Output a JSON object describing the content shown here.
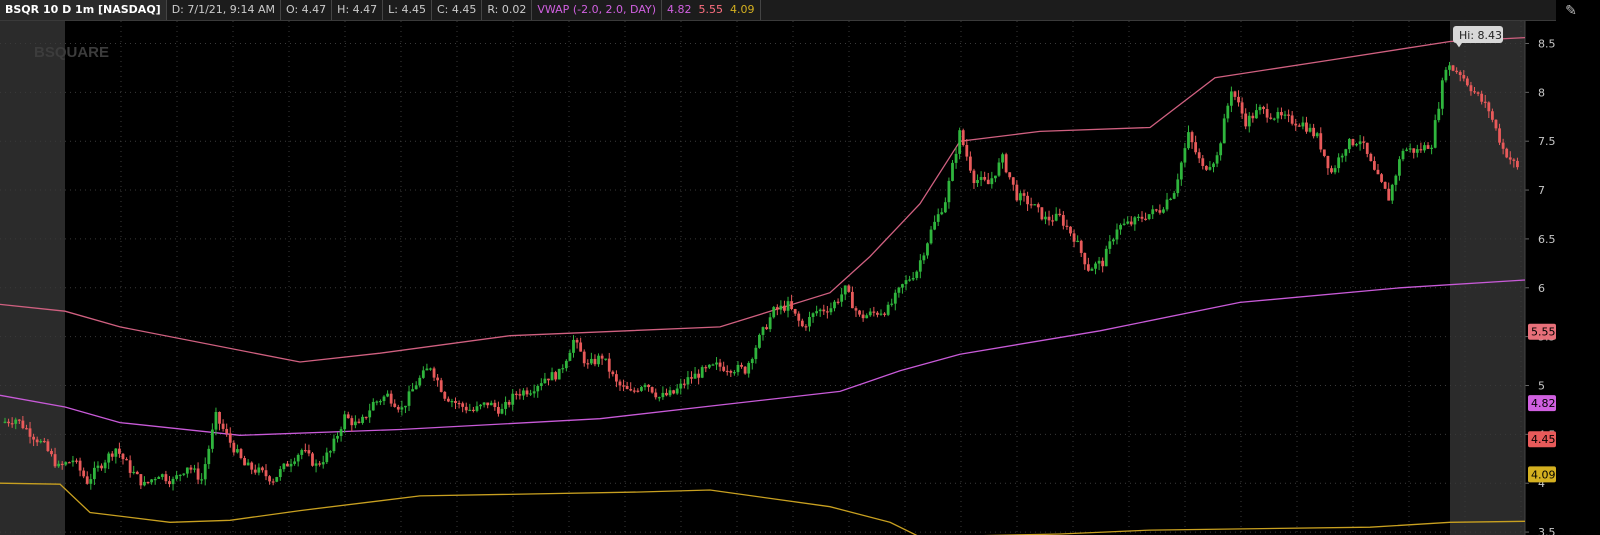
{
  "header": {
    "symbol": "BSQR 10 D 1m [NASDAQ]",
    "date": "D: 7/1/21, 9:14 AM",
    "open": "O: 4.47",
    "high": "H: 4.47",
    "low": "L: 4.45",
    "close": "C: 4.45",
    "range": "R: 0.02",
    "vwap_label": "VWAP (-2.0, 2.0, DAY)",
    "vwap_value": "4.82",
    "upper_value": "5.55",
    "lower_value": "4.09"
  },
  "watermark": "BSQUARE",
  "tools_icon": "pin-icon",
  "colors": {
    "up": "#2fb53d",
    "down": "#e85a5a",
    "vwap": "#c85ad8",
    "upper_band": "#d06080",
    "lower_band": "#c8a020",
    "extended_hours": "#2b2b2b"
  },
  "chart_data": {
    "type": "candlestick",
    "y_ticks": [
      "8.5",
      "8",
      "7.5",
      "7",
      "6.5",
      "6",
      "5.5",
      "5",
      "4.5",
      "4",
      "3.5"
    ],
    "ylim": [
      3.47,
      8.73
    ],
    "price_tags": [
      {
        "label": "5.55",
        "value": 5.55,
        "color": "#e8707a"
      },
      {
        "label": "4.82",
        "value": 4.82,
        "color": "#d060e0"
      },
      {
        "label": "4.45",
        "value": 4.45,
        "color": "#e85a5a"
      },
      {
        "label": "4.09",
        "value": 4.09,
        "color": "#d4b020"
      }
    ],
    "hi_label": "Hi: 8.43",
    "hi_value": 8.43,
    "close_path": [
      4.62,
      4.66,
      4.52,
      4.38,
      4.16,
      4.24,
      4.02,
      4.2,
      4.36,
      4.14,
      3.98,
      4.1,
      4.02,
      4.18,
      4.04,
      4.68,
      4.42,
      4.18,
      4.12,
      4.04,
      4.2,
      4.34,
      4.18,
      4.32,
      4.68,
      4.58,
      4.82,
      4.9,
      4.76,
      5.02,
      5.2,
      4.9,
      4.8,
      4.74,
      4.82,
      4.74,
      4.92,
      4.96,
      5.08,
      5.12,
      5.46,
      5.2,
      5.3,
      5.02,
      4.92,
      5.04,
      4.88,
      4.92,
      5.06,
      5.14,
      5.2,
      5.18,
      5.16,
      5.48,
      5.76,
      5.82,
      5.6,
      5.76,
      5.8,
      5.98,
      5.7,
      5.74,
      5.78,
      6.02,
      6.18,
      6.58,
      6.9,
      7.58,
      7.12,
      7.06,
      7.32,
      6.94,
      6.86,
      6.7,
      6.72,
      6.52,
      6.2,
      6.26,
      6.62,
      6.66,
      6.74,
      6.8,
      7.0,
      7.56,
      7.22,
      7.34,
      8.04,
      7.7,
      7.82,
      7.76,
      7.72,
      7.68,
      7.54,
      7.18,
      7.46,
      7.52,
      7.18,
      6.92,
      7.42,
      7.4,
      7.48,
      8.28,
      8.2,
      8.0,
      7.82,
      7.42,
      7.22
    ],
    "vwap": [
      [
        0,
        4.9
      ],
      [
        65,
        4.78
      ],
      [
        120,
        4.62
      ],
      [
        240,
        4.49
      ],
      [
        400,
        4.55
      ],
      [
        600,
        4.66
      ],
      [
        720,
        4.8
      ],
      [
        840,
        4.94
      ],
      [
        900,
        5.15
      ],
      [
        960,
        5.32
      ],
      [
        1100,
        5.56
      ],
      [
        1240,
        5.85
      ],
      [
        1400,
        6.0
      ],
      [
        1525,
        6.08
      ]
    ],
    "upper_band": [
      [
        0,
        5.83
      ],
      [
        65,
        5.76
      ],
      [
        120,
        5.6
      ],
      [
        300,
        5.24
      ],
      [
        380,
        5.33
      ],
      [
        510,
        5.51
      ],
      [
        720,
        5.6
      ],
      [
        830,
        5.95
      ],
      [
        870,
        6.32
      ],
      [
        920,
        6.86
      ],
      [
        960,
        7.5
      ],
      [
        1040,
        7.6
      ],
      [
        1150,
        7.64
      ],
      [
        1215,
        8.15
      ],
      [
        1330,
        8.33
      ],
      [
        1450,
        8.52
      ],
      [
        1525,
        8.56
      ]
    ],
    "lower_band": [
      [
        0,
        4.0
      ],
      [
        60,
        3.99
      ],
      [
        90,
        3.7
      ],
      [
        170,
        3.6
      ],
      [
        230,
        3.62
      ],
      [
        300,
        3.72
      ],
      [
        420,
        3.87
      ],
      [
        640,
        3.91
      ],
      [
        710,
        3.93
      ],
      [
        830,
        3.76
      ],
      [
        890,
        3.6
      ],
      [
        920,
        3.45
      ],
      [
        1060,
        3.48
      ],
      [
        1150,
        3.52
      ],
      [
        1370,
        3.55
      ],
      [
        1450,
        3.6
      ],
      [
        1525,
        3.61
      ]
    ]
  }
}
